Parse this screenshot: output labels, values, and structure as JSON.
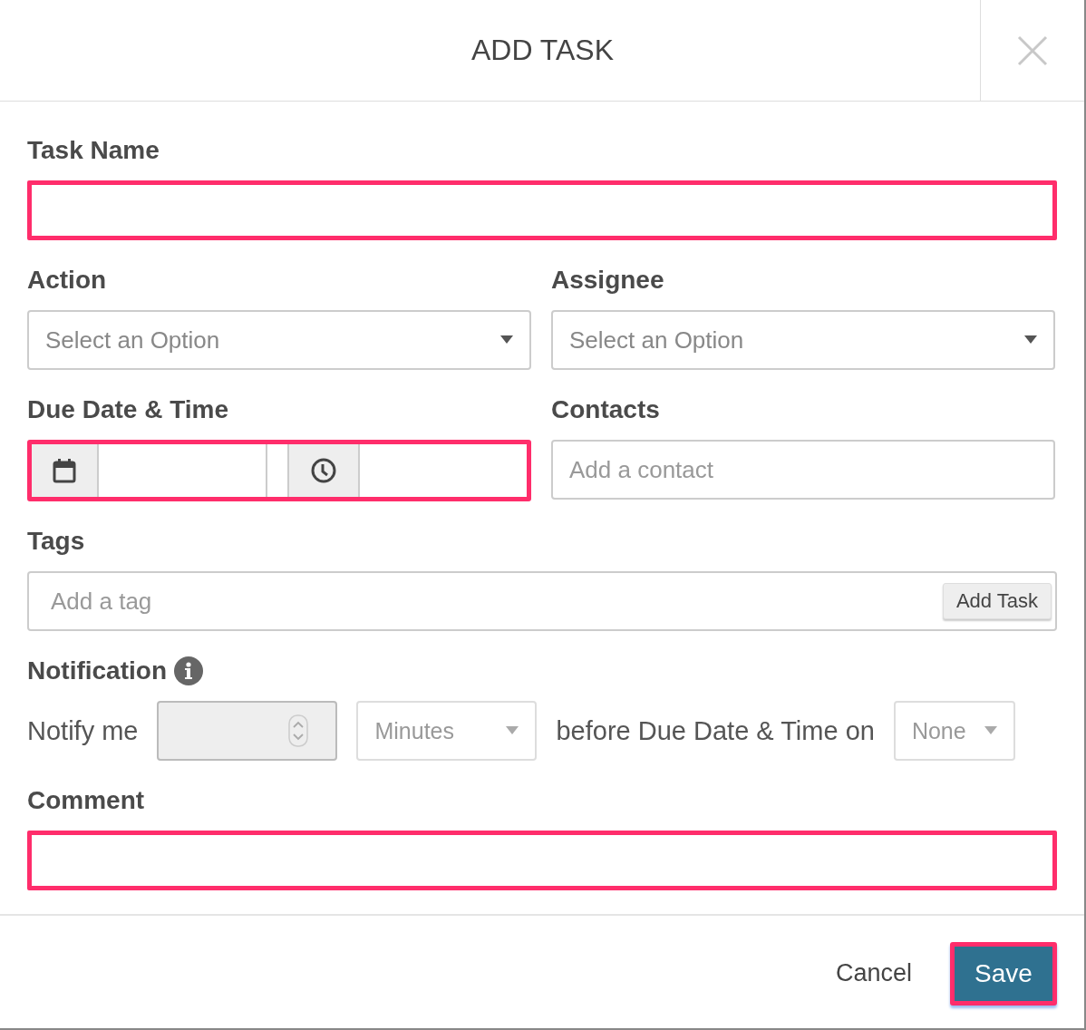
{
  "dialog": {
    "title": "ADD TASK"
  },
  "task_name": {
    "label": "Task Name",
    "highlighted": true
  },
  "action": {
    "label": "Action",
    "placeholder": "Select an Option"
  },
  "assignee": {
    "label": "Assignee",
    "placeholder": "Select an Option"
  },
  "due": {
    "label": "Due Date & Time",
    "highlighted": true
  },
  "contacts": {
    "label": "Contacts",
    "placeholder": "Add a contact"
  },
  "tags": {
    "label": "Tags",
    "placeholder": "Add a tag",
    "button": "Add Task"
  },
  "notification": {
    "label": "Notification",
    "prefix": "Notify me",
    "amount": {
      "disabled": true
    },
    "unit": "Minutes",
    "middle": "before Due Date & Time on",
    "target": "None"
  },
  "comment": {
    "label": "Comment",
    "highlighted": true
  },
  "footer": {
    "cancel": "Cancel",
    "save": {
      "label": "Save",
      "highlighted": true
    }
  }
}
